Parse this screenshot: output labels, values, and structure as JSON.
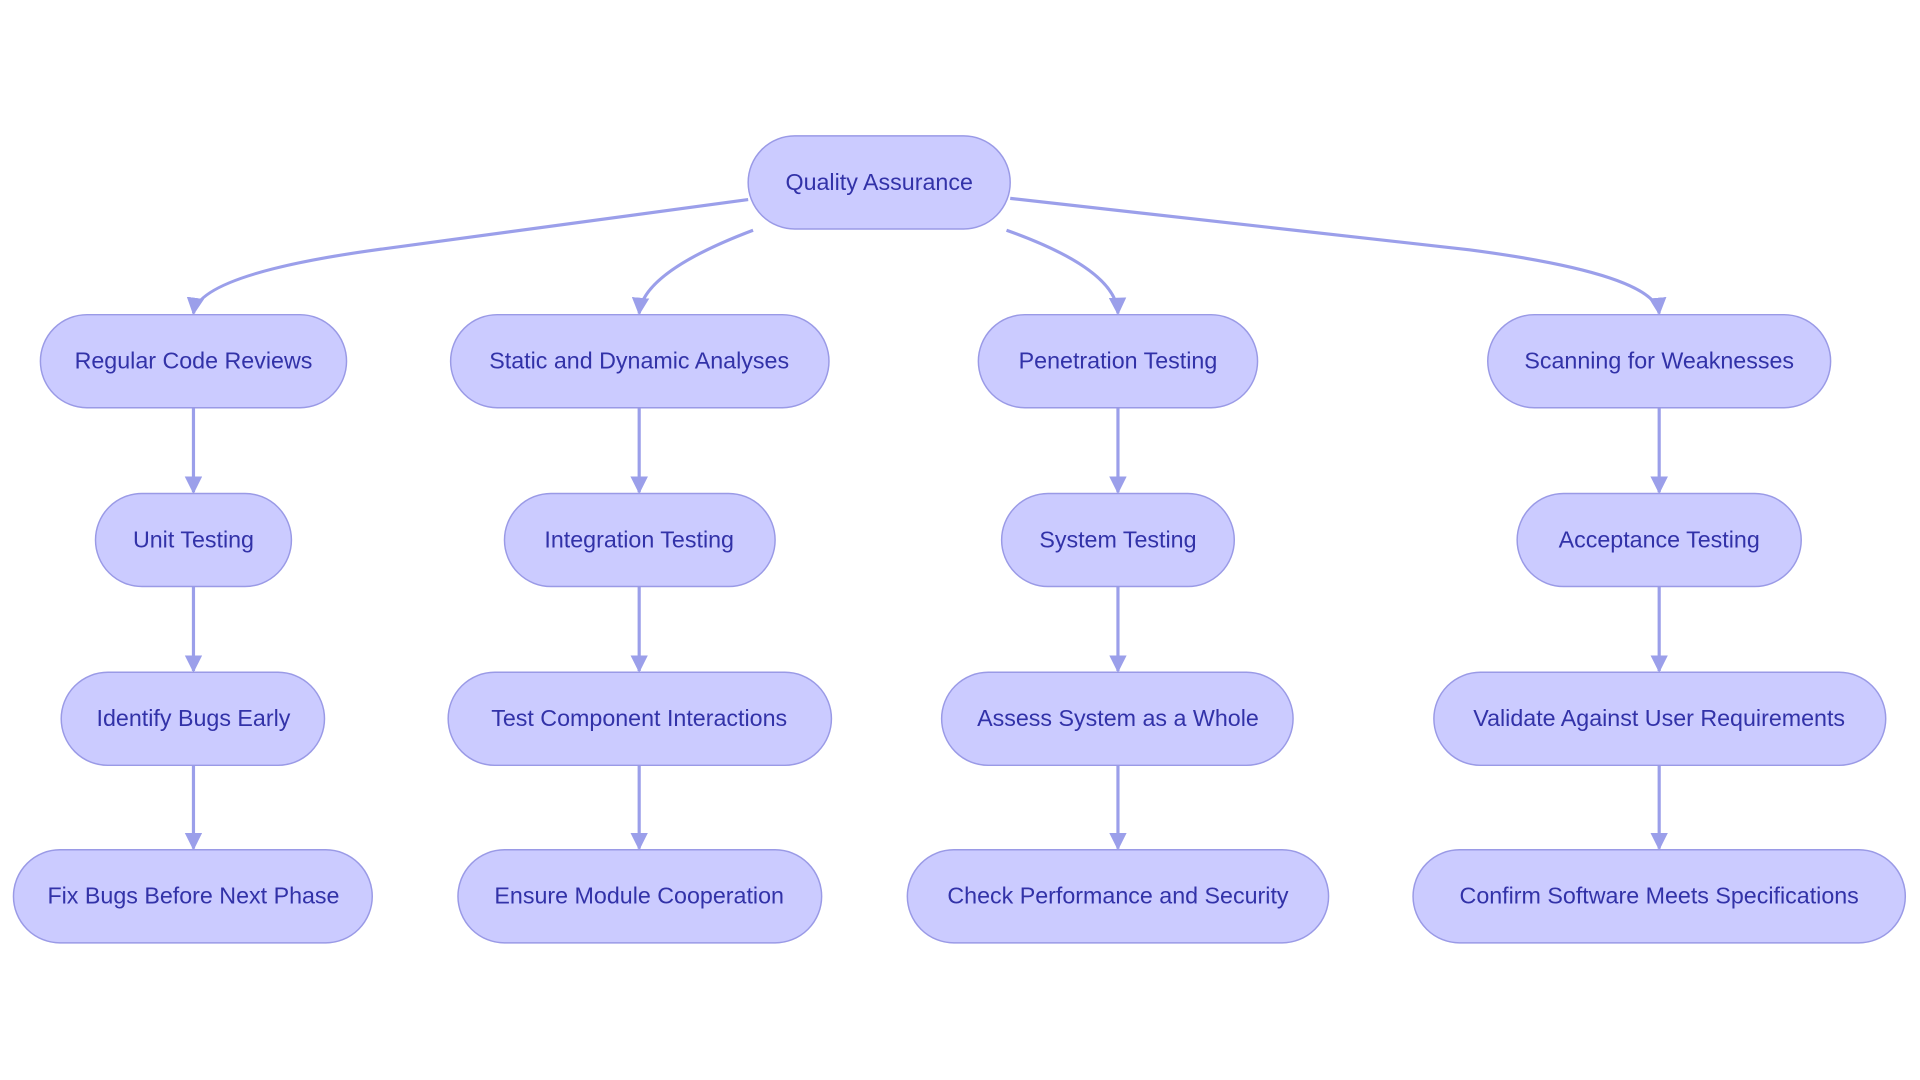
{
  "colors": {
    "node_fill": "#cbcbff",
    "node_stroke": "#9a9ae6",
    "edge": "#9b9fea",
    "text": "#3232a8"
  },
  "root": {
    "label": "Quality Assurance"
  },
  "branches": [
    {
      "label": "Regular Code Reviews",
      "children": [
        "Unit Testing",
        "Identify Bugs Early",
        "Fix Bugs Before Next Phase"
      ]
    },
    {
      "label": "Static and Dynamic Analyses",
      "children": [
        "Integration Testing",
        "Test Component Interactions",
        "Ensure Module Cooperation"
      ]
    },
    {
      "label": "Penetration Testing",
      "children": [
        "System Testing",
        "Assess System as a Whole",
        "Check Performance and Security"
      ]
    },
    {
      "label": "Scanning for Weaknesses",
      "children": [
        "Acceptance Testing",
        "Validate Against User Requirements",
        "Confirm Software Meets Specifications"
      ]
    }
  ]
}
